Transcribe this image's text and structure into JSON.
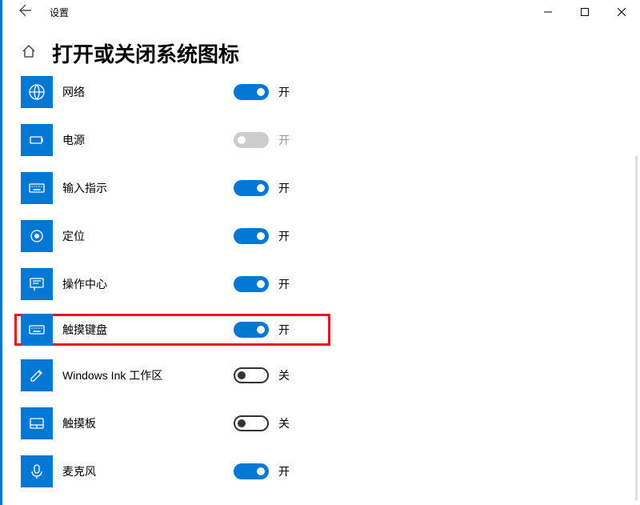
{
  "app": {
    "title": "设置"
  },
  "page": {
    "title": "打开或关闭系统图标"
  },
  "labels": {
    "on": "开",
    "off": "关"
  },
  "items": [
    {
      "label": "网络",
      "state": "on",
      "icon": "globe"
    },
    {
      "label": "电源",
      "state": "disabled",
      "icon": "power"
    },
    {
      "label": "输入指示",
      "state": "on",
      "icon": "keyboard"
    },
    {
      "label": "定位",
      "state": "on",
      "icon": "location"
    },
    {
      "label": "操作中心",
      "state": "on",
      "icon": "action"
    },
    {
      "label": "触摸键盘",
      "state": "on",
      "icon": "keyboard",
      "highlight": true
    },
    {
      "label": "Windows Ink 工作区",
      "state": "off",
      "icon": "pen"
    },
    {
      "label": "触摸板",
      "state": "off",
      "icon": "touchpad"
    },
    {
      "label": "麦克风",
      "state": "on",
      "icon": "mic"
    }
  ]
}
